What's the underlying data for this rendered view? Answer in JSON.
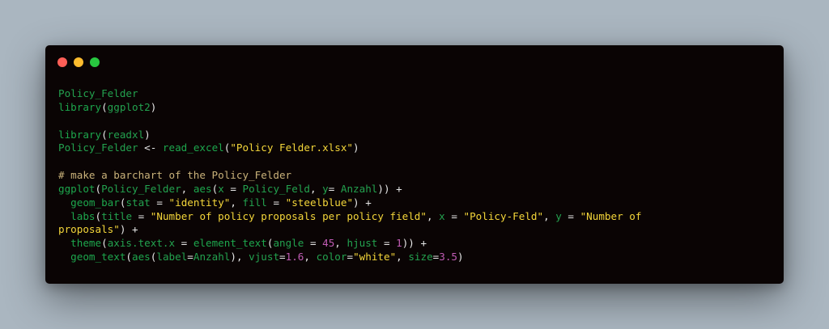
{
  "window": {
    "traffic_lights": [
      {
        "name": "close",
        "color": "#ff5f57"
      },
      {
        "name": "minimize",
        "color": "#febc2e"
      },
      {
        "name": "zoom",
        "color": "#28c840"
      }
    ]
  },
  "code": {
    "l1": "Policy_Felder",
    "l2_fn": "library",
    "l2_open": "(",
    "l2_arg": "ggplot2",
    "l2_close": ")",
    "l4_fn": "library",
    "l4_open": "(",
    "l4_arg": "readxl",
    "l4_close": ")",
    "l5_var": "Policy_Felder",
    "l5_assign": " <- ",
    "l5_fn": "read_excel",
    "l5_open": "(",
    "l5_str": "\"Policy Felder.xlsx\"",
    "l5_close": ")",
    "l7_comment": "# make a barchart of the Policy_Felder",
    "l8_fn": "ggplot",
    "l8_open": "(",
    "l8_arg1": "Policy_Felder",
    "l8_comma": ", ",
    "l8_aes": "aes",
    "l8_open2": "(",
    "l8_x": "x",
    "l8_eq1": " = ",
    "l8_xv": "Policy_Feld",
    "l8_comma2": ", ",
    "l8_y": "y",
    "l8_eq2": "= ",
    "l8_yv": "Anzahl",
    "l8_close": ")) +",
    "l9_indent": "  ",
    "l9_fn": "geom_bar",
    "l9_open": "(",
    "l9_stat": "stat",
    "l9_eq1": " = ",
    "l9_statv": "\"identity\"",
    "l9_comma": ", ",
    "l9_fill": "fill",
    "l9_eq2": " = ",
    "l9_fillv": "\"steelblue\"",
    "l9_close": ") +",
    "l10_indent": "  ",
    "l10_fn": "labs",
    "l10_open": "(",
    "l10_title": "title",
    "l10_eq1": " = ",
    "l10_titlev": "\"Number of policy proposals per policy field\"",
    "l10_comma1": ", ",
    "l10_x": "x",
    "l10_eq2": " = ",
    "l10_xv": "\"Policy-Feld\"",
    "l10_comma2": ", ",
    "l10_y": "y",
    "l10_eq3": " = ",
    "l10_yv1": "\"Number of",
    "l11_yv2": "proposals\"",
    "l11_close": ") +",
    "l12_indent": "  ",
    "l12_fn": "theme",
    "l12_open": "(",
    "l12_arg": "axis.text.x",
    "l12_eq1": " = ",
    "l12_fn2": "element_text",
    "l12_open2": "(",
    "l12_angle": "angle",
    "l12_eq2": " = ",
    "l12_anglev": "45",
    "l12_comma": ", ",
    "l12_hjust": "hjust",
    "l12_eq3": " = ",
    "l12_hjustv": "1",
    "l12_close": ")) +",
    "l13_indent": "  ",
    "l13_fn": "geom_text",
    "l13_open": "(",
    "l13_aes": "aes",
    "l13_open2": "(",
    "l13_label": "label",
    "l13_eq1": "=",
    "l13_labelv": "Anzahl",
    "l13_close1": "), ",
    "l13_vjust": "vjust",
    "l13_eq2": "=",
    "l13_vjustv": "1.6",
    "l13_comma1": ", ",
    "l13_color": "color",
    "l13_eq3": "=",
    "l13_colorv": "\"white\"",
    "l13_comma2": ", ",
    "l13_size": "size",
    "l13_eq4": "=",
    "l13_sizev": "3.5",
    "l13_close2": ")"
  }
}
